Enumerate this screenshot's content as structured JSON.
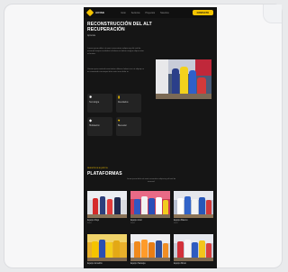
{
  "header": {
    "logo": "ARISE",
    "nav": [
      "Inicio",
      "Servicios",
      "Proyectos",
      "Nosotros"
    ],
    "cta": "CONTACTO"
  },
  "hero": {
    "title": "RECONSTRUCCIÓN DEL ALT RECUPERACIÓN",
    "subtitle": "Aprende"
  },
  "about": {
    "p1": "Lorem ipsum dolor sit amet consectetur adipiscing elit sed do eiusmod tempor incididunt ut labore et dolore magna aliqua enim ad minim.",
    "p2": "Veniam quis nostrud exercitation ullamco laboris nisi ut aliquip ex ea commodo consequat duis aute irure dolor in."
  },
  "features": [
    {
      "icon": "gear-icon",
      "glyph": "✱",
      "label": "Tecnología"
    },
    {
      "icon": "chart-icon",
      "glyph": "▮",
      "label": "Resultados"
    },
    {
      "icon": "drop-icon",
      "glyph": "◆",
      "label": "Hidratación"
    },
    {
      "icon": "heart-icon",
      "glyph": "♥",
      "label": "Bienestar"
    }
  ],
  "section": {
    "kicker": "NUESTROS EQUIPOS",
    "title": "PLATAFORMAS",
    "desc": "Lorem ipsum dolor sit amet consectetur adipiscing elit sed do eiusmod."
  },
  "tiles": [
    {
      "caption": "Equipo Rojo",
      "meta": "2024"
    },
    {
      "caption": "Equipo Azul",
      "meta": "2024"
    },
    {
      "caption": "Equipo Blanco",
      "meta": "2023"
    },
    {
      "caption": "Equipo Amarillo",
      "meta": "2023"
    },
    {
      "caption": "Equipo Naranja",
      "meta": "2022"
    },
    {
      "caption": "Equipo Mixto",
      "meta": "2022"
    }
  ],
  "colors": {
    "accent": "#f5c400",
    "page_bg": "#151515"
  }
}
